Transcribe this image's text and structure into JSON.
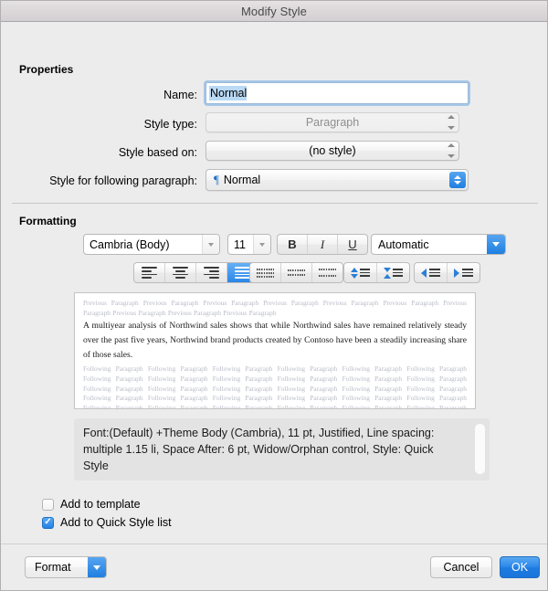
{
  "window": {
    "title": "Modify Style"
  },
  "properties": {
    "section_label": "Properties",
    "name_label": "Name:",
    "name_value": "Normal",
    "style_type_label": "Style type:",
    "style_type_value": "Paragraph",
    "style_based_on_label": "Style based on:",
    "style_based_on_value": "(no style)",
    "style_following_label": "Style for following paragraph:",
    "style_following_value": "Normal",
    "pilcrow_glyph": "¶"
  },
  "formatting": {
    "section_label": "Formatting",
    "font_family": "Cambria (Body)",
    "font_size": "11",
    "bold_label": "B",
    "italic_label": "I",
    "underline_label": "U",
    "font_color": "Automatic",
    "align_buttons": [
      {
        "name": "align-left",
        "active": false
      },
      {
        "name": "align-center",
        "active": false
      },
      {
        "name": "align-right",
        "active": false
      },
      {
        "name": "align-justify",
        "active": true
      }
    ],
    "line_spacing_buttons": [
      {
        "name": "line-spacing-single"
      },
      {
        "name": "line-spacing-one-half"
      },
      {
        "name": "line-spacing-double"
      }
    ],
    "paragraph_spacing_buttons": [
      {
        "name": "decrease-paragraph-spacing"
      },
      {
        "name": "increase-paragraph-spacing"
      }
    ],
    "indent_buttons": [
      {
        "name": "decrease-indent"
      },
      {
        "name": "increase-indent"
      }
    ]
  },
  "preview": {
    "previous_paragraph": "Previous Paragraph Previous Paragraph Previous Paragraph Previous Paragraph Previous Paragraph Previous Paragraph Previous Paragraph Previous Paragraph Previous Paragraph Previous Paragraph",
    "sample_text": "A multiyear analysis of Northwind sales shows that while Northwind sales have remained relatively steady over the past five years, Northwind brand products created by Contoso have been a steadily increasing share of those sales.",
    "following_paragraph": "Following Paragraph Following Paragraph Following Paragraph Following Paragraph Following Paragraph Following Paragraph Following Paragraph Following Paragraph Following Paragraph Following Paragraph Following Paragraph Following Paragraph Following Paragraph Following Paragraph Following Paragraph Following Paragraph Following Paragraph Following Paragraph Following Paragraph Following Paragraph Following Paragraph Following Paragraph Following Paragraph Following Paragraph Following Paragraph Following Paragraph Following Paragraph Following Paragraph Following Paragraph Following Paragraph Following Paragraph Following Paragraph Following Paragraph Following Paragraph"
  },
  "description": {
    "text": "Font:(Default) +Theme Body (Cambria), 11 pt, Justified, Line spacing:  multiple 1.15 li, Space After:  6 pt, Widow/Orphan control, Style: Quick Style"
  },
  "options": {
    "add_to_template": {
      "label": "Add to template",
      "checked": false
    },
    "add_to_quick_style_list": {
      "label": "Add to Quick Style list",
      "checked": true
    },
    "check_glyph": "✓"
  },
  "footer": {
    "format_label": "Format",
    "cancel_label": "Cancel",
    "ok_label": "OK"
  },
  "colors": {
    "accent": "#2480e4",
    "selection": "#b9d9f4",
    "window_bg": "#ececec",
    "title_text": "#4a4a4a"
  }
}
